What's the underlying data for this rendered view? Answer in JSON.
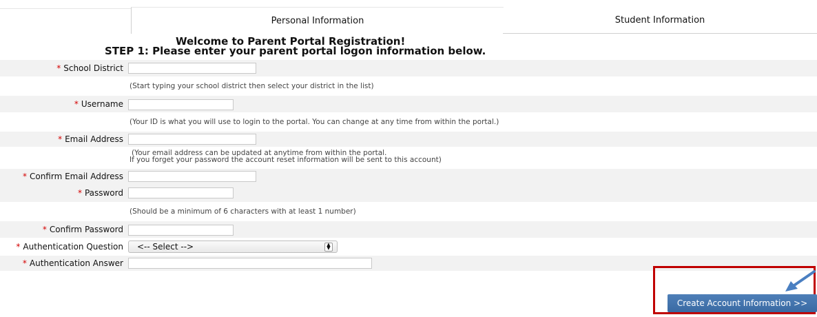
{
  "tabs": {
    "personal": "Personal Information",
    "student": "Student Information"
  },
  "heading": {
    "line1": "Welcome to Parent Portal Registration!",
    "line2": "STEP 1: Please enter your parent portal logon information below."
  },
  "fields": {
    "school_district": {
      "label": "School District",
      "value": "",
      "help": "(Start typing your school district then select your district in the list)"
    },
    "username": {
      "label": "Username",
      "value": "",
      "help": "(Your ID is what you will use to login to the portal. You can change at any time from within the portal.)"
    },
    "email": {
      "label": "Email Address",
      "value": "",
      "help1": "(Your email address can be updated at anytime from within the portal.",
      "help2": "If you forget your password the account reset information will be sent to this account)"
    },
    "confirm_email": {
      "label": "Confirm Email Address",
      "value": ""
    },
    "password": {
      "label": "Password",
      "value": "",
      "help": "(Should be a minimum of 6 characters with at least 1 number)"
    },
    "confirm_password": {
      "label": "Confirm Password",
      "value": ""
    },
    "auth_question": {
      "label": "Authentication Question",
      "selected": "<-- Select -->"
    },
    "auth_answer": {
      "label": "Authentication Answer",
      "value": ""
    }
  },
  "required_mark": "*",
  "button": {
    "label": "Create Account Information >>"
  },
  "colors": {
    "required": "#d40000",
    "button": "#3f6fa8",
    "highlight_box": "#c00000",
    "arrow": "#4a7fc1"
  },
  "icons": {
    "select_arrow": "updown-arrow-icon",
    "pointer": "annotation-arrow-icon"
  }
}
